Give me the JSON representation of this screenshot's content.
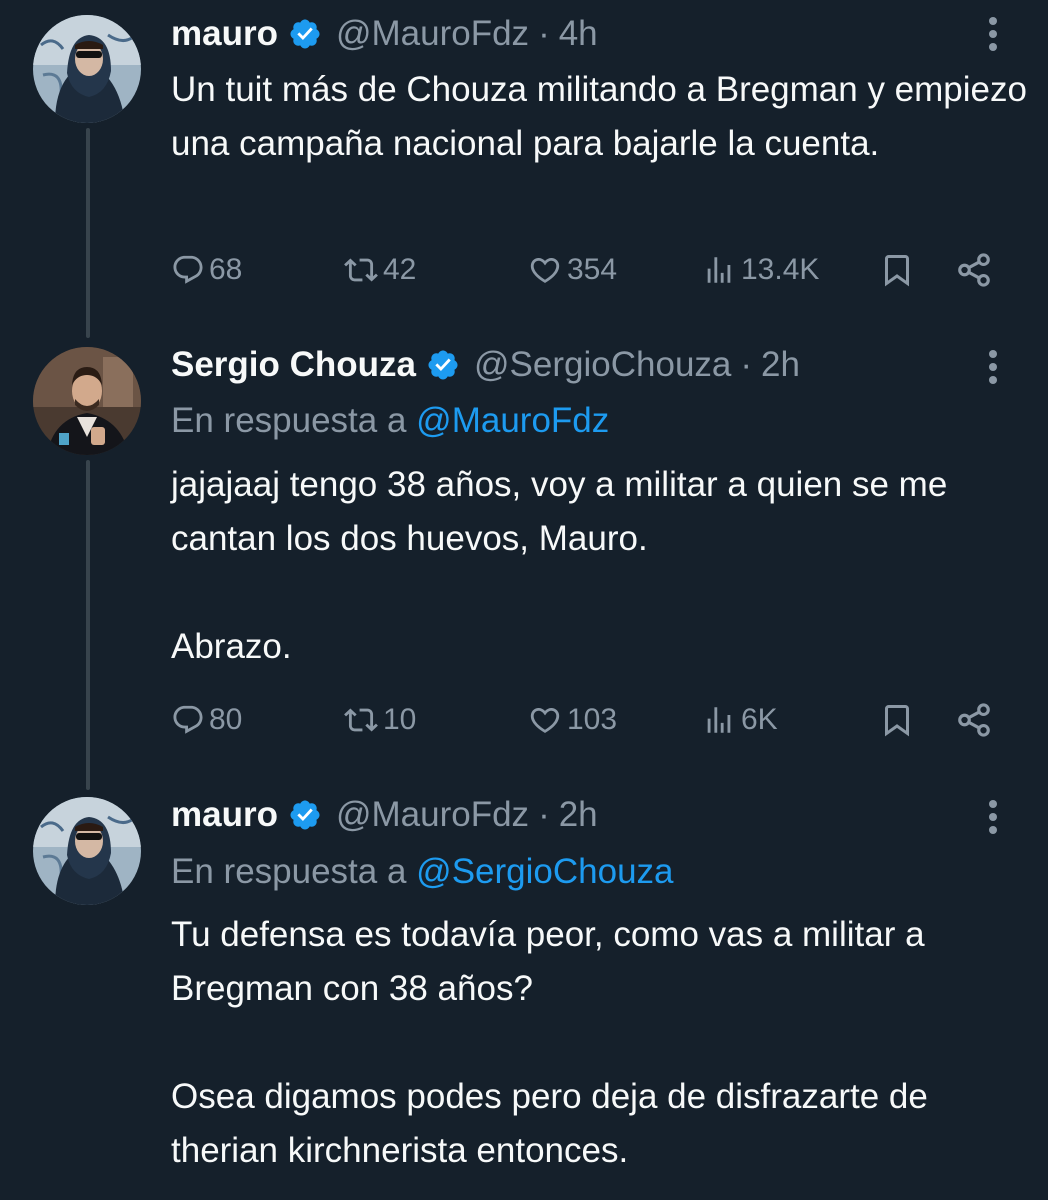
{
  "tweets": [
    {
      "name": "mauro",
      "handle": "@MauroFdz",
      "separator": "·",
      "time": "4h",
      "reply_prefix": "",
      "reply_handle": "",
      "paragraphs": [
        "Un tuit más de Chouza militando a Bregman y empiezo una campaña nacional para bajarle la cuenta."
      ],
      "replies": "68",
      "reposts": "42",
      "likes": "354",
      "views": "13.4K"
    },
    {
      "name": "Sergio Chouza",
      "handle": "@SergioChouza",
      "separator": "·",
      "time": "2h",
      "reply_prefix": "En respuesta a",
      "reply_handle": "@MauroFdz",
      "paragraphs": [
        "jajajaaj tengo 38 años, voy a militar a quien se me cantan los dos huevos, Mauro.",
        "Abrazo."
      ],
      "replies": "80",
      "reposts": "10",
      "likes": "103",
      "views": "6K"
    },
    {
      "name": "mauro",
      "handle": "@MauroFdz",
      "separator": "·",
      "time": "2h",
      "reply_prefix": "En respuesta a",
      "reply_handle": "@SergioChouza",
      "paragraphs": [
        "Tu defensa es todavía peor, como vas a militar a Bregman con 38 años?",
        "Osea digamos podes pero deja de disfrazarte de therian kirchnerista entonces."
      ]
    }
  ],
  "icons": {
    "verified": "verified-badge-icon",
    "more": "more-options-icon",
    "reply": "reply-icon",
    "repost": "repost-icon",
    "like": "like-icon",
    "views": "views-icon",
    "bookmark": "bookmark-icon",
    "share": "share-icon"
  },
  "colors": {
    "background": "#15202b",
    "text": "#f7f9f9",
    "secondary": "#8b98a5",
    "accent": "#1d9bf0",
    "thread_line": "#38444d"
  }
}
